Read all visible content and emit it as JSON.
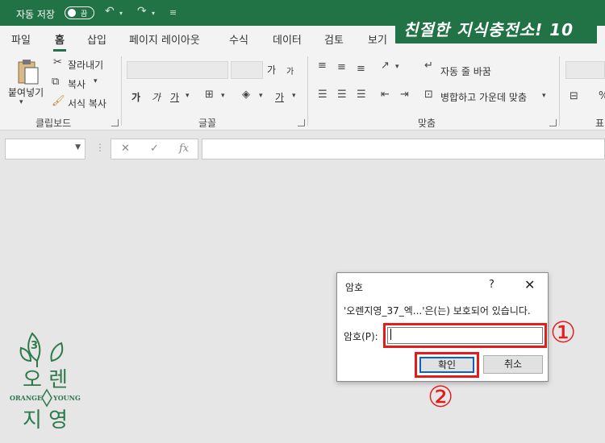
{
  "titlebar": {
    "autosave_label": "자동 저장",
    "toggle_state": "끔",
    "banner": "친절한 지식충전소! 10"
  },
  "tabs": [
    "파일",
    "홈",
    "삽입",
    "페이지 레이아웃",
    "수식",
    "데이터",
    "검토",
    "보기"
  ],
  "ribbon": {
    "clipboard": {
      "paste": "붙여넣기",
      "cut": "잘라내기",
      "copy": "복사",
      "format_painter": "서식 복사",
      "group": "클립보드"
    },
    "font": {
      "grow": "가",
      "shrink": "가",
      "bold": "가",
      "italic": "가",
      "underline": "가",
      "font_color": "가",
      "group": "글꼴"
    },
    "alignment": {
      "wrap_text": "자동 줄 바꿈",
      "merge_center": "병합하고 가운데 맞춤",
      "group": "맞춤"
    },
    "number_group_partial": "표"
  },
  "formula_bar": {
    "fx": "fx"
  },
  "dialog": {
    "title": "암호",
    "help": "?",
    "message": "'오렌지영_37_엑...'은(는) 보호되어 있습니다.",
    "password_label": "암호(P):",
    "ok": "확인",
    "cancel": "취소"
  },
  "markers": {
    "one": "①",
    "two": "②"
  },
  "logo": {
    "top": "오  렌",
    "bottom": "지  영",
    "left_text": "ORANGE",
    "right_text": "YOUNG",
    "center_mark": "3"
  },
  "colors": {
    "excel_green": "#217346",
    "highlight_red": "#e41c1c",
    "focus_blue": "#0a64c8"
  }
}
